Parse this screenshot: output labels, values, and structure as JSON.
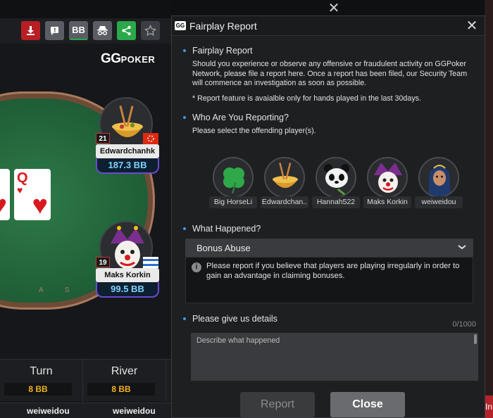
{
  "game": {
    "logo_gg": "GG",
    "logo_poker": "POKER",
    "toolbar": {
      "download_icon": "download-icon",
      "flag_icon": "flag-report-icon",
      "bb_label": "BB",
      "spy_icon": "incognito-icon",
      "share_icon": "share-icon",
      "star_icon": "star-icon",
      "colors": {
        "download": "#b81e24",
        "share": "#2aa84a"
      }
    },
    "board_cards": [
      {
        "rank": "Q",
        "suit": "♥"
      }
    ],
    "rail_text": "A S",
    "players": [
      {
        "name": "Edwardchanhk",
        "stack": "187.3 BB",
        "level": "21"
      },
      {
        "name": "Maks Korkin",
        "stack": "99.5 BB",
        "level": "19"
      }
    ],
    "streets": [
      {
        "name": "Turn",
        "pot": "8 BB"
      },
      {
        "name": "River",
        "pot": "8 BB"
      }
    ],
    "bottom_names": [
      "weiweidou",
      "weiweidou"
    ],
    "right_tag": "In"
  },
  "dialog": {
    "title": "Fairplay Report",
    "logo_text": "GG",
    "intro": {
      "heading": "Fairplay Report",
      "body": "Should you experience or observe any offensive or fraudulent activity on GGPoker Network, please file a report here. Once a report has been filed, our Security Team will commence an investigation as soon as possible.",
      "note": "* Report feature is avaialble only for hands played in the last 30days."
    },
    "who": {
      "heading": "Who Are You Reporting?",
      "subheading": "Please select the offending player(s).",
      "players": [
        "Big HorseLi",
        "Edwardchan..",
        "Hannah522",
        "Maks Korkin",
        "weiweidou"
      ]
    },
    "what": {
      "heading": "What Happened?",
      "selected": "Bonus Abuse",
      "info": "Please report if you believe that players are playing irregularly in order to gain an advantage in claiming bonuses."
    },
    "details": {
      "heading": "Please give us details",
      "counter": "0/1000",
      "placeholder": "Describe what happened"
    },
    "buttons": {
      "report": "Report",
      "close": "Close"
    },
    "accent": "#3d9be9"
  }
}
